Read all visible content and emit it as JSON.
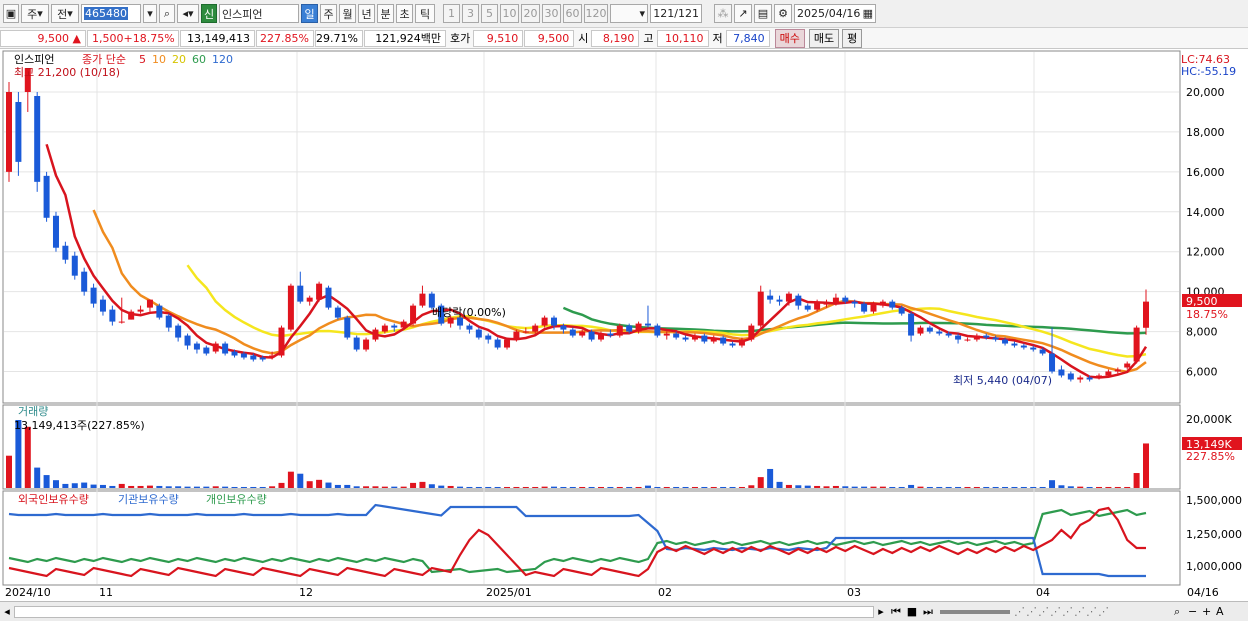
{
  "toolbar": {
    "period_type": "주",
    "prev_label": "전",
    "code": "465480",
    "badge": "신",
    "stock_name": "인스피언",
    "period_tabs": [
      "일",
      "주",
      "월",
      "년",
      "분",
      "초",
      "틱"
    ],
    "intervals": [
      "1",
      "3",
      "5",
      "10",
      "20",
      "30",
      "60",
      "120"
    ],
    "count": "121",
    "count_total": "/121",
    "date": "2025/04/16"
  },
  "info": {
    "price": "9,500",
    "change_arrow": "▲",
    "change": "1,500",
    "change_pct": "+18.75%",
    "volume": "13,149,413",
    "vol_ratio": "227.85%",
    "turnover": "29.71%",
    "amount": "121,924백만",
    "quote_label": "호가",
    "ask": "9,510",
    "bid": "9,500",
    "open_label": "시",
    "open": "8,190",
    "high_label": "고",
    "high": "10,110",
    "low_label": "저",
    "low": "7,840",
    "buy": "매수",
    "sell": "매도",
    "eval": "평"
  },
  "price_panel": {
    "legend_name": "인스피언",
    "legend_ma_title": "종가 단순",
    "ma_periods": [
      "5",
      "10",
      "20",
      "60",
      "120"
    ],
    "ma_colors": [
      "#d8141e",
      "#f08c1e",
      "#f5e61e",
      "#2e9b4e",
      "#2e6ad0"
    ],
    "high_note": "최고 21,200 (10/18)",
    "low_note": "최저 5,440 (04/07)",
    "dividend_note": "배당락(0.00%)",
    "lc": "LC:74.63",
    "hc": "HC:-55.19",
    "last_price_tag": "9,500",
    "last_pct_tag": "18.75%"
  },
  "volume_panel": {
    "title": "거래량",
    "current": "13,149,413주(227.85%)",
    "tag_value": "13,149K",
    "tag_pct": "227.85%",
    "y_tick": "20,000K"
  },
  "holding_panel": {
    "series": [
      "외국인보유수량",
      "기관보유수량",
      "개인보유수량"
    ],
    "colors": [
      "#d8141e",
      "#2e6ad0",
      "#2e9b4e"
    ],
    "y_ticks": [
      "1,500,000",
      "1,250,000",
      "1,000,000"
    ]
  },
  "x_axis": {
    "labels": [
      "2024/10",
      "11",
      "12",
      "2025/01",
      "02",
      "03",
      "04"
    ],
    "last_date": "04/16"
  },
  "chart_data": {
    "type": "candlestick",
    "ylim": [
      5000,
      21500
    ],
    "y_ticks": [
      "20,000",
      "18,000",
      "16,000",
      "14,000",
      "12,000",
      "10,000",
      "8,000",
      "6,000"
    ],
    "candles": [
      [
        16000,
        20000,
        20500,
        15500
      ],
      [
        19500,
        16500,
        20000,
        15800
      ],
      [
        20000,
        21200,
        21200,
        19000
      ],
      [
        19800,
        15500,
        20000,
        15000
      ],
      [
        15800,
        13700,
        16000,
        13500
      ],
      [
        13800,
        12200,
        14000,
        12000
      ],
      [
        12300,
        11600,
        12500,
        11400
      ],
      [
        11800,
        10800,
        12000,
        10600
      ],
      [
        11000,
        10000,
        11200,
        9800
      ],
      [
        10200,
        9400,
        10400,
        9200
      ],
      [
        9600,
        9000,
        9800,
        8800
      ],
      [
        9100,
        8500,
        9300,
        8300
      ],
      [
        8500,
        8500,
        9700,
        8400
      ],
      [
        8600,
        9000,
        9100,
        8600
      ],
      [
        9000,
        9100,
        9300,
        8900
      ],
      [
        9200,
        9600,
        9600,
        9000
      ],
      [
        9300,
        8700,
        9400,
        8600
      ],
      [
        8800,
        8200,
        8900,
        8000
      ],
      [
        8300,
        7700,
        8400,
        7500
      ],
      [
        7800,
        7300,
        7900,
        7100
      ],
      [
        7400,
        7100,
        7500,
        6900
      ],
      [
        7200,
        6900,
        7300,
        6800
      ],
      [
        7000,
        7400,
        7500,
        6900
      ],
      [
        7400,
        6900,
        7500,
        6800
      ],
      [
        7000,
        6800,
        7100,
        6700
      ],
      [
        6900,
        6700,
        7000,
        6600
      ],
      [
        6800,
        6600,
        6900,
        6500
      ],
      [
        6700,
        6600,
        6800,
        6500
      ],
      [
        6700,
        6800,
        7000,
        6600
      ],
      [
        6800,
        8200,
        8300,
        6700
      ],
      [
        8100,
        10300,
        10400,
        8000
      ],
      [
        10300,
        9500,
        11000,
        9400
      ],
      [
        9500,
        9700,
        9800,
        9300
      ],
      [
        9600,
        10400,
        10500,
        9500
      ],
      [
        10200,
        9200,
        10300,
        9100
      ],
      [
        9200,
        8700,
        9300,
        8600
      ],
      [
        8700,
        7700,
        8800,
        7600
      ],
      [
        7700,
        7100,
        7800,
        7000
      ],
      [
        7100,
        7600,
        7700,
        7000
      ],
      [
        7600,
        8100,
        8200,
        7500
      ],
      [
        8000,
        8300,
        8400,
        7900
      ],
      [
        8300,
        8200,
        8400,
        8000
      ],
      [
        8200,
        8500,
        8600,
        8100
      ],
      [
        8400,
        9300,
        9400,
        8300
      ],
      [
        9300,
        9900,
        10300,
        9200
      ],
      [
        9900,
        9200,
        10000,
        9100
      ],
      [
        9300,
        8400,
        9400,
        8300
      ],
      [
        8400,
        8700,
        8800,
        8200
      ],
      [
        8700,
        8300,
        8800,
        8100
      ],
      [
        8300,
        8100,
        8400,
        7900
      ],
      [
        8100,
        7700,
        8200,
        7600
      ],
      [
        7800,
        7600,
        7900,
        7400
      ],
      [
        7600,
        7200,
        7700,
        7100
      ],
      [
        7200,
        7600,
        7700,
        7100
      ],
      [
        7600,
        8000,
        8100,
        7500
      ],
      [
        8000,
        8000,
        8200,
        7900
      ],
      [
        8000,
        8300,
        8400,
        7900
      ],
      [
        8300,
        8700,
        8800,
        8200
      ],
      [
        8700,
        8300,
        8800,
        8100
      ],
      [
        8300,
        8100,
        8400,
        7900
      ],
      [
        8100,
        7800,
        8200,
        7700
      ],
      [
        7800,
        8000,
        8100,
        7700
      ],
      [
        8000,
        7600,
        8100,
        7500
      ],
      [
        7600,
        7900,
        8000,
        7500
      ],
      [
        7900,
        7800,
        8100,
        7700
      ],
      [
        7800,
        8300,
        8400,
        7700
      ],
      [
        8300,
        8000,
        8400,
        7900
      ],
      [
        8000,
        8400,
        8500,
        7900
      ],
      [
        8400,
        8300,
        9300,
        8200
      ],
      [
        8300,
        7800,
        8400,
        7700
      ],
      [
        7800,
        7900,
        8000,
        7600
      ],
      [
        7900,
        7700,
        8000,
        7600
      ],
      [
        7700,
        7600,
        7800,
        7500
      ],
      [
        7600,
        7800,
        7900,
        7500
      ],
      [
        7800,
        7500,
        7900,
        7400
      ],
      [
        7500,
        7700,
        7800,
        7400
      ],
      [
        7700,
        7400,
        7800,
        7300
      ],
      [
        7400,
        7300,
        7500,
        7200
      ],
      [
        7300,
        7600,
        7700,
        7200
      ],
      [
        7600,
        8300,
        8400,
        7500
      ],
      [
        8300,
        10000,
        10300,
        8200
      ],
      [
        9800,
        9600,
        10100,
        9400
      ],
      [
        9600,
        9500,
        9800,
        9300
      ],
      [
        9500,
        9900,
        10000,
        9300
      ],
      [
        9800,
        9300,
        9900,
        9100
      ],
      [
        9300,
        9100,
        9400,
        9000
      ],
      [
        9100,
        9500,
        9600,
        9000
      ],
      [
        9400,
        9400,
        9600,
        9200
      ],
      [
        9400,
        9700,
        9900,
        9300
      ],
      [
        9700,
        9500,
        9800,
        9400
      ],
      [
        9500,
        9400,
        9600,
        9200
      ],
      [
        9400,
        9000,
        9500,
        8900
      ],
      [
        9000,
        9400,
        9500,
        8900
      ],
      [
        9300,
        9500,
        9600,
        9200
      ],
      [
        9500,
        9200,
        9600,
        9100
      ],
      [
        9200,
        8900,
        9300,
        8800
      ],
      [
        8900,
        7800,
        9000,
        7500
      ],
      [
        7900,
        8200,
        8300,
        7800
      ],
      [
        8200,
        8000,
        8300,
        7900
      ],
      [
        8000,
        7900,
        8100,
        7800
      ],
      [
        7900,
        7800,
        8000,
        7700
      ],
      [
        7800,
        7600,
        7900,
        7400
      ],
      [
        7600,
        7600,
        7700,
        7500
      ],
      [
        7600,
        7800,
        7900,
        7500
      ],
      [
        7800,
        7700,
        7900,
        7600
      ],
      [
        7700,
        7600,
        7800,
        7500
      ],
      [
        7600,
        7400,
        7700,
        7300
      ],
      [
        7400,
        7300,
        7500,
        7200
      ],
      [
        7300,
        7200,
        7400,
        7100
      ],
      [
        7200,
        7100,
        7300,
        7000
      ],
      [
        7100,
        6900,
        7200,
        6800
      ],
      [
        6900,
        6000,
        8200,
        5900
      ],
      [
        6100,
        5800,
        6300,
        5700
      ],
      [
        5900,
        5600,
        6000,
        5500
      ],
      [
        5600,
        5700,
        5800,
        5440
      ],
      [
        5700,
        5600,
        5800,
        5500
      ],
      [
        5700,
        5800,
        5900,
        5600
      ],
      [
        5800,
        6000,
        6100,
        5700
      ],
      [
        6000,
        6100,
        6200,
        5900
      ],
      [
        6200,
        6400,
        6500,
        6100
      ],
      [
        6500,
        8200,
        8300,
        6400
      ],
      [
        8190,
        9500,
        10110,
        7840
      ]
    ],
    "volumes": [
      9.5,
      20,
      18,
      6,
      3.8,
      2.3,
      1.2,
      1.4,
      1.6,
      1,
      0.9,
      0.6,
      1.2,
      0.6,
      0.6,
      0.7,
      0.6,
      0.5,
      0.5,
      0.4,
      0.4,
      0.4,
      0.5,
      0.4,
      0.3,
      0.3,
      0.3,
      0.3,
      0.5,
      1.5,
      4.8,
      4.2,
      2,
      2.4,
      1.6,
      0.9,
      0.9,
      0.5,
      0.5,
      0.5,
      0.4,
      0.4,
      0.4,
      1.5,
      1.8,
      1.1,
      0.7,
      0.6,
      0.4,
      0.3,
      0.3,
      0.3,
      0.3,
      0.3,
      0.3,
      0.3,
      0.3,
      0.4,
      0.4,
      0.3,
      0.3,
      0.3,
      0.3,
      0.3,
      0.3,
      0.3,
      0.3,
      0.3,
      0.7,
      0.3,
      0.3,
      0.3,
      0.3,
      0.3,
      0.3,
      0.3,
      0.3,
      0.3,
      0.3,
      0.8,
      3.2,
      5.6,
      1.8,
      0.9,
      0.8,
      0.7,
      0.6,
      0.5,
      0.6,
      0.5,
      0.4,
      0.4,
      0.4,
      0.4,
      0.3,
      0.3,
      0.9,
      0.4,
      0.3,
      0.3,
      0.3,
      0.3,
      0.3,
      0.3,
      0.3,
      0.3,
      0.3,
      0.3,
      0.3,
      0.3,
      0.3,
      2.3,
      0.8,
      0.5,
      0.4,
      0.3,
      0.3,
      0.3,
      0.3,
      0.3,
      4.4,
      13.1
    ]
  }
}
